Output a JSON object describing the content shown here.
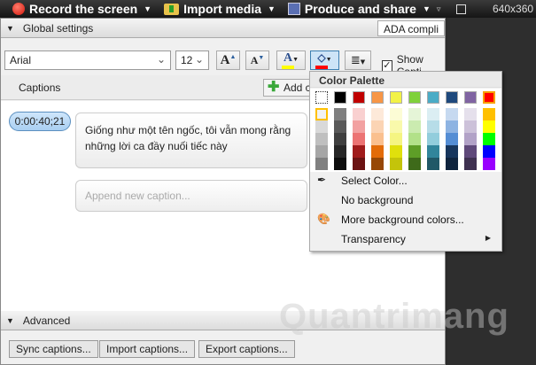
{
  "topbar": {
    "record": "Record the screen",
    "import": "Import media",
    "produce": "Produce and share",
    "resolution": "640x360"
  },
  "global": {
    "title": "Global settings",
    "ada": "ADA compli",
    "font": "Arial",
    "size": "12",
    "show_captions": "Show Capti"
  },
  "captions": {
    "title": "Captions",
    "add": "Add c",
    "items": [
      {
        "time": "0:00:40;21",
        "text": "Giống như một tên ngốc, tôi vẫn mong rằng những lời ca đầy nuối tiếc này"
      }
    ],
    "append_placeholder": "Append new caption..."
  },
  "advanced": {
    "title": "Advanced",
    "sync": "Sync captions...",
    "import": "Import captions...",
    "export": "Export captions..."
  },
  "palette": {
    "title": "Color Palette",
    "top": [
      "transparent",
      "#000000",
      "#c00000",
      "#f79646",
      "#f2f247",
      "#7fd13b",
      "#4bacc6",
      "#1f497d",
      "#8064a2",
      "#ff0000"
    ],
    "columns": [
      [
        "#f2f2f2",
        "#d9d9d9",
        "#bfbfbf",
        "#a6a6a6",
        "#808080"
      ],
      [
        "#7f7f7f",
        "#595959",
        "#3f3f3f",
        "#262626",
        "#0d0d0d"
      ],
      [
        "#f9d0d0",
        "#f2a1a1",
        "#ec7373",
        "#a01b1b",
        "#6b1212"
      ],
      [
        "#fde9d9",
        "#fbd4b4",
        "#fac08f",
        "#e36c09",
        "#974806"
      ],
      [
        "#fcfcd5",
        "#f9f9ab",
        "#f5f582",
        "#e0e00c",
        "#c4c40a"
      ],
      [
        "#e5f5d7",
        "#cbebb0",
        "#b2e189",
        "#5e9e27",
        "#3e6a1a"
      ],
      [
        "#dbeef3",
        "#b7dde8",
        "#92cddc",
        "#31859b",
        "#205867"
      ],
      [
        "#c6d9f0",
        "#8db3e2",
        "#548dd4",
        "#17365d",
        "#0f243e"
      ],
      [
        "#e5e0ec",
        "#ccc1d9",
        "#b2a2c7",
        "#5f497a",
        "#3f3151"
      ],
      [
        "#ffc000",
        "#ffff00",
        "#00ff00",
        "#0000ff",
        "#9900ff"
      ]
    ],
    "menu": {
      "select": "Select Color...",
      "none": "No background",
      "more": "More background colors...",
      "transparency": "Transparency"
    }
  },
  "watermark": "Quantrimang"
}
